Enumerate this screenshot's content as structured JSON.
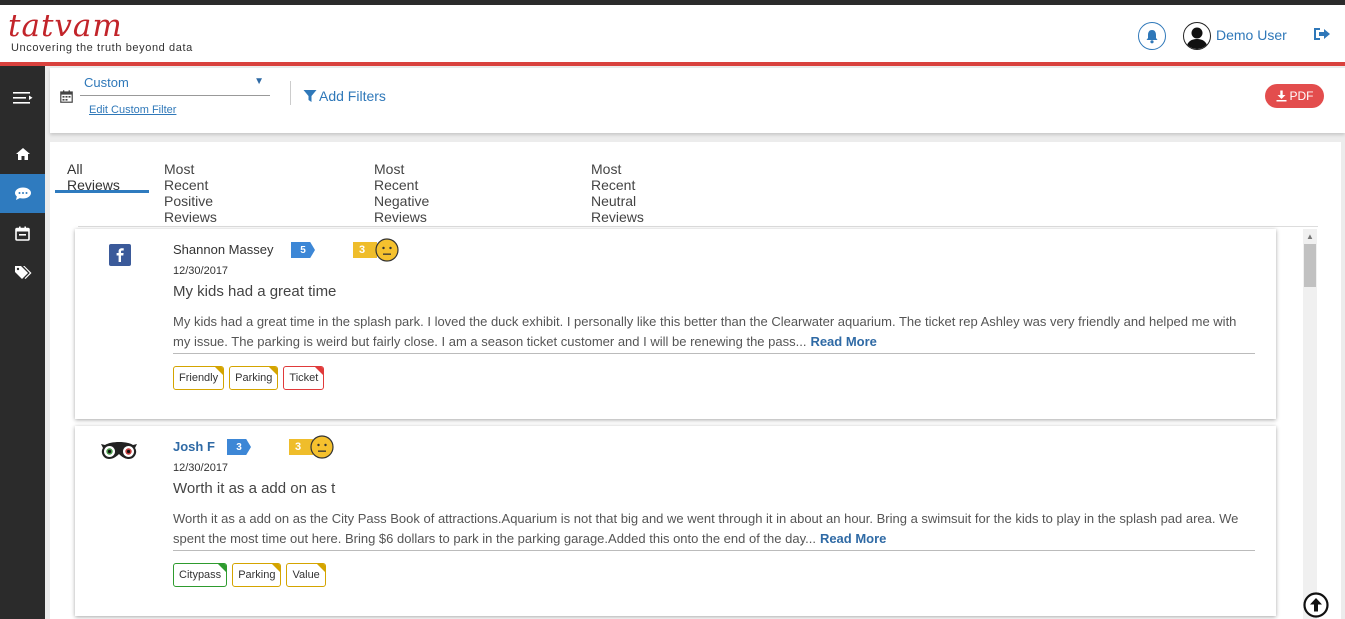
{
  "header": {
    "logo_text": "tatvam",
    "logo_tagline": "Uncovering the truth beyond data",
    "user_name": "Demo User"
  },
  "filters": {
    "date_select_value": "Custom",
    "edit_custom_filter": "Edit Custom Filter",
    "add_filters": "Add Filters",
    "pdf_label": "PDF"
  },
  "tabs": [
    {
      "label": "All Reviews",
      "active": true
    },
    {
      "label": "Most Recent Positive Reviews",
      "active": false
    },
    {
      "label": "Most Recent Negative Reviews",
      "active": false
    },
    {
      "label": "Most Recent Neutral Reviews",
      "active": false
    }
  ],
  "reviews": [
    {
      "source_icon": "facebook-icon",
      "author": "Shannon Massey",
      "author_color": "#333333",
      "author_reviews": "5",
      "rating": "3",
      "sentiment": "neutral-face-icon",
      "date": "12/30/2017",
      "title": "My kids had a great time",
      "body": "My kids had a great time in the splash park. I loved the duck exhibit. I personally like this better than the Clearwater aquarium. The ticket rep Ashley was very friendly and helped me with my issue. The parking is weird but fairly close. I am a season ticket customer and I will be renewing the pass...",
      "read_more": "Read More",
      "tags": [
        {
          "label": "Friendly",
          "color": "#d4a400"
        },
        {
          "label": "Parking",
          "color": "#d4a400"
        },
        {
          "label": "Ticket",
          "color": "#e03a3a"
        }
      ]
    },
    {
      "source_icon": "tripadvisor-icon",
      "author": "Josh F",
      "author_color": "#2f6aa5",
      "author_reviews": "3",
      "rating": "3",
      "sentiment": "neutral-face-icon",
      "date": "12/30/2017",
      "title": "Worth it as a add on as t",
      "body": "Worth it as a add on as the City Pass Book of attractions.Aquarium is not that big and we went through it in about an hour. Bring a swimsuit for the kids to play in the splash pad area. We spent the most time out here. Bring $6 dollars to park in the parking garage.Added this onto the end of the day...",
      "read_more": "Read More",
      "tags": [
        {
          "label": "Citypass",
          "color": "#2e9b2e"
        },
        {
          "label": "Parking",
          "color": "#d4a400"
        },
        {
          "label": "Value",
          "color": "#d4a400"
        }
      ]
    }
  ],
  "colors": {
    "accent": "#2f7bbf",
    "brand_red": "#c2242a",
    "sidebar": "#2b2b2b"
  }
}
